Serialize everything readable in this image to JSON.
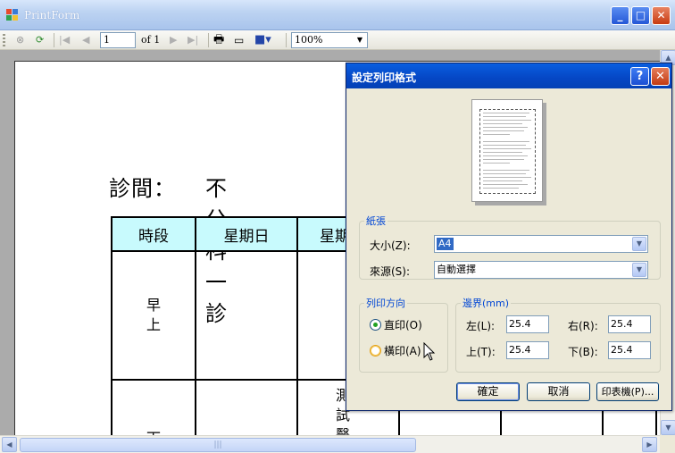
{
  "window": {
    "title": "PrintForm"
  },
  "toolbar": {
    "page_value": "1",
    "of_label": "of 1",
    "zoom_value": "100%"
  },
  "document": {
    "clinic_label": "診間：",
    "clinic_value": "不分科一診",
    "table_headers": [
      "時段",
      "星期日",
      "星期"
    ],
    "row_morning": "早\n上",
    "row_afternoon": "下",
    "cell_test": "測\n試\n醫"
  },
  "dialog": {
    "title": "設定列印格式",
    "paper_group": "紙張",
    "size_label": "大小(Z):",
    "size_value": "A4",
    "source_label": "來源(S):",
    "source_value": "自動選擇",
    "orientation_group": "列印方向",
    "portrait_label": "直印(O)",
    "landscape_label": "橫印(A)",
    "margins_group": "邊界(mm)",
    "left_label": "左(L):",
    "left_value": "25.4",
    "right_label": "右(R):",
    "right_value": "25.4",
    "top_label": "上(T):",
    "top_value": "25.4",
    "bottom_label": "下(B):",
    "bottom_value": "25.4",
    "ok_label": "確定",
    "cancel_label": "取消",
    "printer_label": "印表機(P)..."
  },
  "colors": {
    "header_fill": "#c8fafd",
    "dialog_title": "#0546c4",
    "group_label": "#0046d5"
  }
}
